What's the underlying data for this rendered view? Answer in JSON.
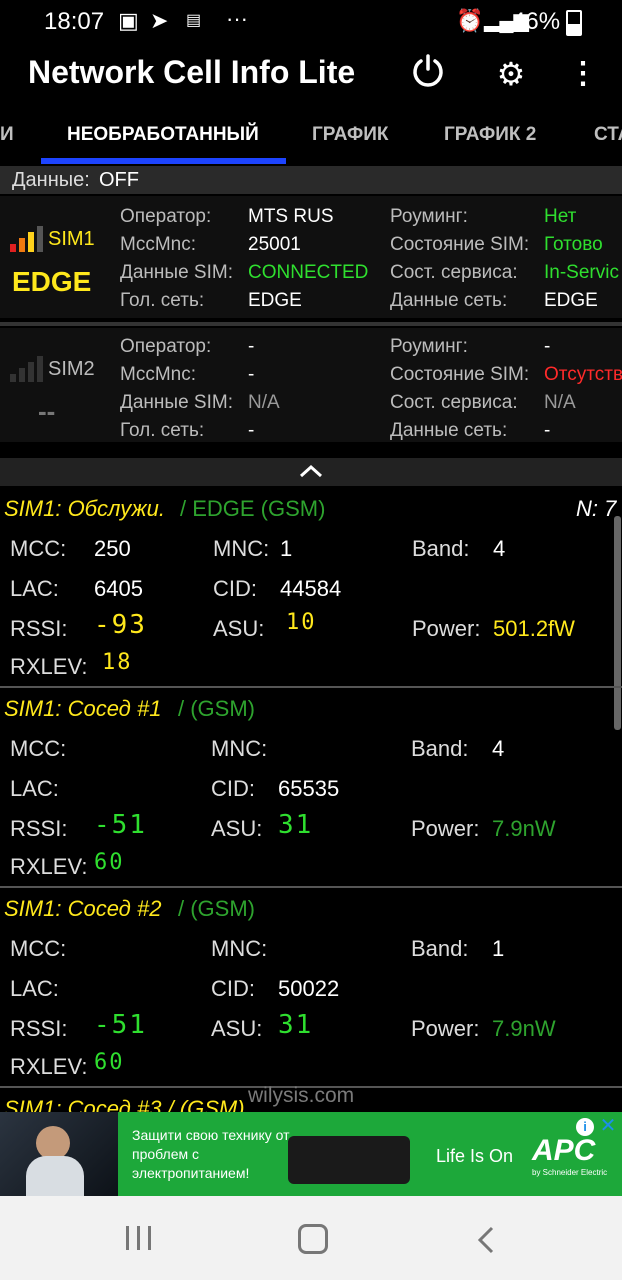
{
  "status": {
    "time": "18:07",
    "battery": "46%"
  },
  "app": {
    "title": "Network Cell Info Lite"
  },
  "tabs": [
    "И",
    "НЕОБРАБОТАННЫЙ",
    "ГРАФИК",
    "ГРАФИК 2",
    "СТА"
  ],
  "data_row": {
    "label": "Данные:",
    "value": "OFF"
  },
  "sim1": {
    "name": "SIM1",
    "tech": "EDGE",
    "left_labels": [
      "Оператор:",
      "MccMnc:",
      "Данные SIM:",
      "Гол. сеть:"
    ],
    "left_values": [
      "MTS RUS",
      "25001",
      "CONNECTED",
      "EDGE"
    ],
    "right_labels": [
      "Роуминг:",
      "Состояние SIM:",
      "Сост. сервиса:",
      "Данные сеть:"
    ],
    "right_values": [
      "Нет",
      "Готово",
      "In-Servic",
      "EDGE"
    ]
  },
  "sim2": {
    "name": "SIM2",
    "tech": "--",
    "left_labels": [
      "Оператор:",
      "MccMnc:",
      "Данные SIM:",
      "Гол. сеть:"
    ],
    "left_values": [
      "-",
      "-",
      "N/A",
      "-"
    ],
    "right_labels": [
      "Роуминг:",
      "Состояние SIM:",
      "Сост. сервиса:",
      "Данные сеть:"
    ],
    "right_values": [
      "-",
      "Отсутств",
      "N/A",
      "-"
    ]
  },
  "serving": {
    "title": "SIM1: Обслужи.",
    "sub": "/ EDGE (GSM)",
    "n": "N: 7",
    "mcc_label": "MCC:",
    "mcc": "250",
    "mnc_label": "MNC:",
    "mnc": "1",
    "band_label": "Band:",
    "band": "4",
    "lac_label": "LAC:",
    "lac": "6405",
    "cid_label": "CID:",
    "cid": "44584",
    "rssi_label": "RSSI:",
    "rssi": "-93",
    "asu_label": "ASU:",
    "asu": "10",
    "power_label": "Power:",
    "power": "501.2fW",
    "rxlev_label": "RXLEV:",
    "rxlev": "18"
  },
  "neighbor1": {
    "title": "SIM1: Сосед #1",
    "sub": "/ (GSM)",
    "mcc_label": "MCC:",
    "mnc_label": "MNC:",
    "band_label": "Band:",
    "band": "4",
    "lac_label": "LAC:",
    "cid_label": "CID:",
    "cid": "65535",
    "rssi_label": "RSSI:",
    "rssi": "-51",
    "asu_label": "ASU:",
    "asu": "31",
    "power_label": "Power:",
    "power": "7.9nW",
    "rxlev_label": "RXLEV:",
    "rxlev": "60"
  },
  "neighbor2": {
    "title": "SIM1: Сосед #2",
    "sub": "/ (GSM)",
    "mcc_label": "MCC:",
    "mnc_label": "MNC:",
    "band_label": "Band:",
    "band": "1",
    "lac_label": "LAC:",
    "cid_label": "CID:",
    "cid": "50022",
    "rssi_label": "RSSI:",
    "rssi": "-51",
    "asu_label": "ASU:",
    "asu": "31",
    "power_label": "Power:",
    "power": "7.9nW",
    "rxlev_label": "RXLEV:",
    "rxlev": "60"
  },
  "neighbor3_partial": "SIM1: Сосед #3 / (GSM)",
  "watermark": "wilysis.com",
  "ad": {
    "text": "Защити свою технику от проблем с электропитанием!",
    "slogan": "Life Is On",
    "brand": "APC",
    "brand_sub": "by Schneider Electric"
  }
}
